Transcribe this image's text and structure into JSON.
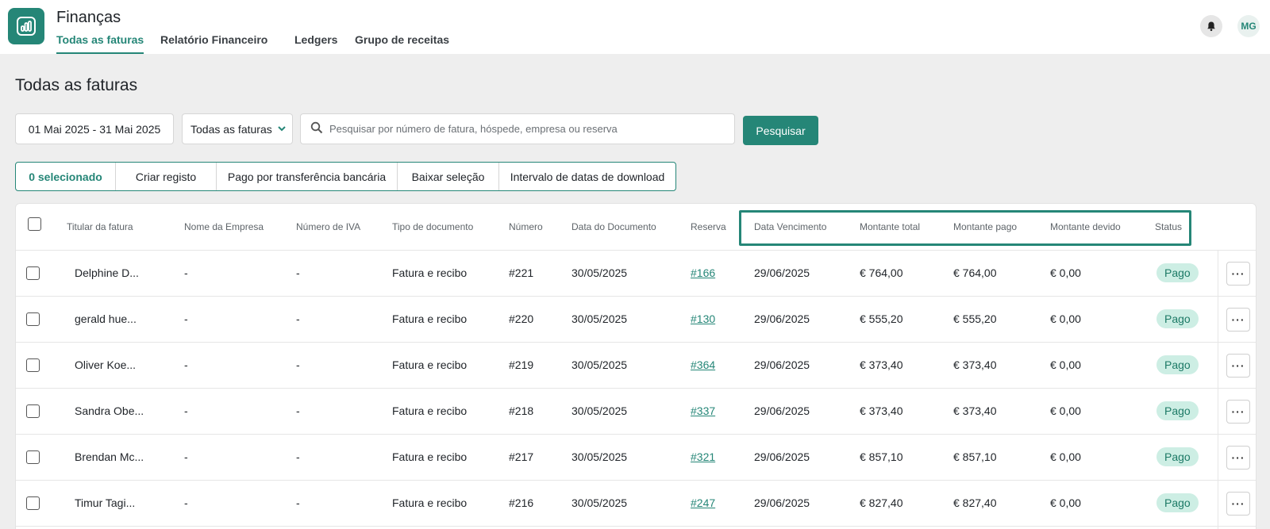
{
  "app": {
    "title": "Finanças",
    "icon": "bar-chart-icon"
  },
  "nav": {
    "tabs": [
      {
        "label": "Todas as faturas",
        "active": true
      },
      {
        "label": "Relatório Financeiro",
        "active": false
      },
      {
        "label": "Ledgers",
        "active": false
      },
      {
        "label": "Grupo de receitas",
        "active": false
      }
    ]
  },
  "user": {
    "initials": "MG",
    "notifications_icon": "bell-icon"
  },
  "page": {
    "title": "Todas as faturas"
  },
  "filters": {
    "date_range": "01 Mai 2025 - 31 Mai 2025",
    "invoice_filter": "Todas as faturas",
    "search_placeholder": "Pesquisar por número de fatura, hóspede, empresa ou reserva",
    "search_value": "",
    "search_button": "Pesquisar"
  },
  "bulk_actions": [
    "0 selecionado",
    "Criar registo",
    "Pago por transferência bancária",
    "Baixar seleção",
    "Intervalo de datas de download"
  ],
  "table": {
    "columns": [
      "Titular da fatura",
      "Nome da Empresa",
      "Número de IVA",
      "Tipo de documento",
      "Número",
      "Data do Documento",
      "Reserva",
      "Data Vencimento",
      "Montante total",
      "Montante pago",
      "Montante devido",
      "Status"
    ],
    "rows": [
      {
        "holder": "Delphine D...",
        "company": "-",
        "vat": "-",
        "doc_type": "Fatura e recibo",
        "number": "#221",
        "doc_date": "30/05/2025",
        "reservation": "#166",
        "due_date": "29/06/2025",
        "total": "€ 764,00",
        "paid": "€ 764,00",
        "due": "€ 0,00",
        "status": "Pago"
      },
      {
        "holder": "gerald hue...",
        "company": "-",
        "vat": "-",
        "doc_type": "Fatura e recibo",
        "number": "#220",
        "doc_date": "30/05/2025",
        "reservation": "#130",
        "due_date": "29/06/2025",
        "total": "€ 555,20",
        "paid": "€ 555,20",
        "due": "€ 0,00",
        "status": "Pago"
      },
      {
        "holder": "Oliver Koe...",
        "company": "-",
        "vat": "-",
        "doc_type": "Fatura e recibo",
        "number": "#219",
        "doc_date": "30/05/2025",
        "reservation": "#364",
        "due_date": "29/06/2025",
        "total": "€ 373,40",
        "paid": "€ 373,40",
        "due": "€ 0,00",
        "status": "Pago"
      },
      {
        "holder": "Sandra Obe...",
        "company": "-",
        "vat": "-",
        "doc_type": "Fatura e recibo",
        "number": "#218",
        "doc_date": "30/05/2025",
        "reservation": "#337",
        "due_date": "29/06/2025",
        "total": "€ 373,40",
        "paid": "€ 373,40",
        "due": "€ 0,00",
        "status": "Pago"
      },
      {
        "holder": "Brendan Mc...",
        "company": "-",
        "vat": "-",
        "doc_type": "Fatura e recibo",
        "number": "#217",
        "doc_date": "30/05/2025",
        "reservation": "#321",
        "due_date": "29/06/2025",
        "total": "€ 857,10",
        "paid": "€ 857,10",
        "due": "€ 0,00",
        "status": "Pago"
      },
      {
        "holder": "Timur Tagi...",
        "company": "-",
        "vat": "-",
        "doc_type": "Fatura e recibo",
        "number": "#216",
        "doc_date": "30/05/2025",
        "reservation": "#247",
        "due_date": "29/06/2025",
        "total": "€ 827,40",
        "paid": "€ 827,40",
        "due": "€ 0,00",
        "status": "Pago"
      }
    ]
  },
  "colors": {
    "accent": "#258677",
    "status_paid_bg": "#cdeee4",
    "status_paid_text": "#1d7a66",
    "background": "#eeeeee"
  }
}
